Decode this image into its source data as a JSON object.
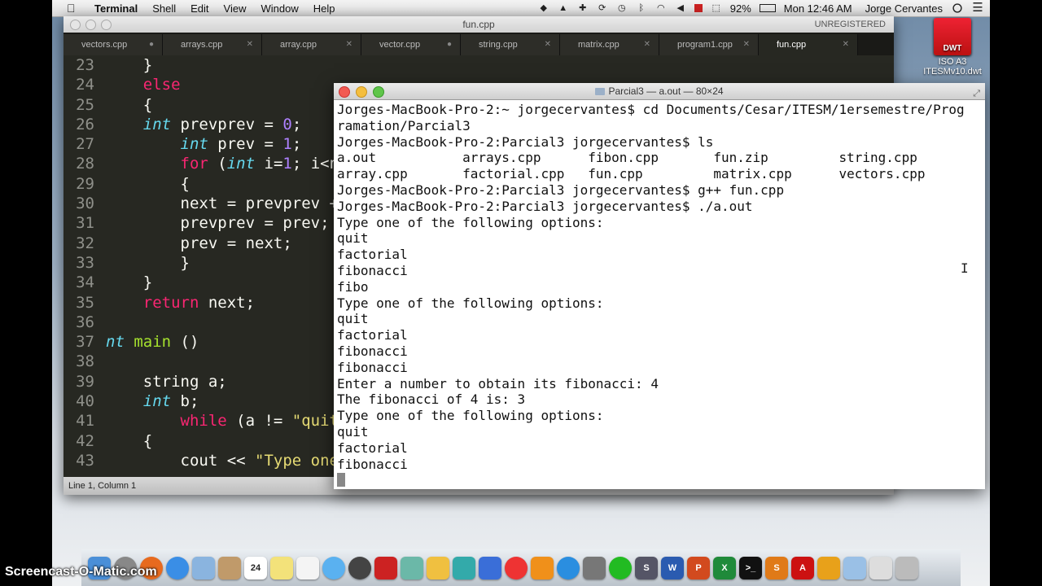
{
  "menubar": {
    "app": "Terminal",
    "items": [
      "Shell",
      "Edit",
      "View",
      "Window",
      "Help"
    ],
    "battery": "92%",
    "clock": "Mon 12:46 AM",
    "user": "Jorge Cervantes"
  },
  "desktop_icon": {
    "badge": "DWT",
    "label_line1": "ISO A3",
    "label_line2": "ITESMv10.dwt"
  },
  "editor": {
    "title": "fun.cpp",
    "unregistered": "UNREGISTERED",
    "tabs": [
      "vectors.cpp",
      "arrays.cpp",
      "array.cpp",
      "vector.cpp",
      "string.cpp",
      "matrix.cpp",
      "program1.cpp",
      "fun.cpp"
    ],
    "active_tab": "fun.cpp",
    "line_numbers": [
      "23",
      "24",
      "25",
      "26",
      "27",
      "28",
      "29",
      "30",
      "31",
      "32",
      "33",
      "34",
      "35",
      "36",
      "37",
      "38",
      "39",
      "40",
      "41",
      "42",
      "43"
    ],
    "status": "Line 1, Column 1"
  },
  "terminal": {
    "title": "Parcial3 — a.out — 80×24",
    "lines": [
      "Jorges-MacBook-Pro-2:~ jorgecervantes$ cd Documents/Cesar/ITESM/1ersemestre/Prog",
      "ramation/Parcial3",
      "Jorges-MacBook-Pro-2:Parcial3 jorgecervantes$ ls",
      "a.out           arrays.cpp      fibon.cpp       fun.zip         string.cpp",
      "array.cpp       factorial.cpp   fun.cpp         matrix.cpp      vectors.cpp",
      "Jorges-MacBook-Pro-2:Parcial3 jorgecervantes$ g++ fun.cpp",
      "Jorges-MacBook-Pro-2:Parcial3 jorgecervantes$ ./a.out",
      "Type one of the following options:",
      "quit",
      "factorial",
      "fibonacci",
      "fibo",
      "Type one of the following options:",
      "quit",
      "factorial",
      "fibonacci",
      "fibonacci",
      "Enter a number to obtain its fibonacci: 4",
      "The fibonacci of 4 is: 3",
      "Type one of the following options:",
      "quit",
      "factorial",
      "fibonacci"
    ]
  },
  "dock": {
    "date_icon_label": "24",
    "watermark": "Screencast-O-Matic.com"
  }
}
